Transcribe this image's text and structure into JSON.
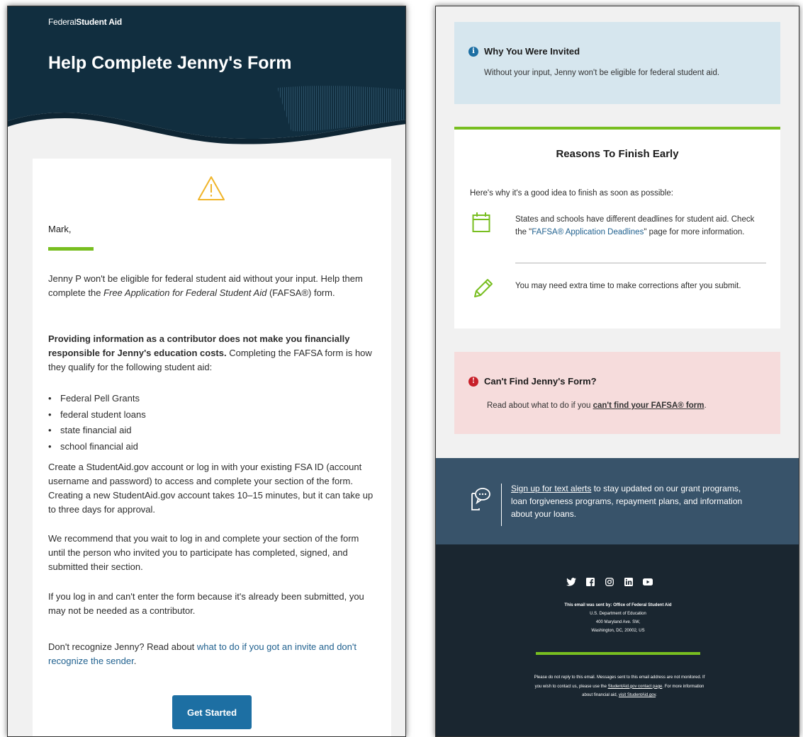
{
  "left": {
    "brand_federal": "Federal",
    "brand_student_aid": "Student Aid",
    "title": "Help Complete Jenny's Form",
    "greeting": "Mark,",
    "para1_a": "Jenny P won't be eligible for federal student aid without your input. Help them complete the ",
    "para1_italic": "Free Application for Federal Student Aid",
    "para1_b": " (FAFSA®) form.",
    "para2_bold": "Providing information as a contributor does not make you financially responsible for Jenny's education costs.",
    "para2_rest": " Completing the FAFSA form is how they qualify for the following student aid:",
    "aid_list": [
      "Federal Pell Grants",
      "federal student loans",
      "state financial aid",
      "school financial aid"
    ],
    "para3": "Create a StudentAid.gov account or log in with your existing FSA ID (account username and password) to access and complete your section of the form. Creating a new StudentAid.gov account takes 10–15 minutes, but it can take up to three days for approval.",
    "para4": "We recommend that you wait to log in and complete your section of the form until the person who invited you to participate has completed, signed, and submitted their section.",
    "para5": "If you log in and can't enter the form because it's already been submitted, you may not be needed as a contributor.",
    "para6_a": "Don't recognize Jenny? Read about ",
    "para6_link": "what to do if you got an invite and don't recognize the sender",
    "para6_b": ".",
    "button": "Get Started"
  },
  "right": {
    "invited_title": "Why You Were Invited",
    "invited_text": "Without your input, Jenny won't be eligible for federal student aid.",
    "reasons_title": "Reasons To Finish Early",
    "reasons_intro": "Here's why it's a good idea to finish as soon as possible:",
    "reason1_a": "States and schools have different deadlines for student aid. Check the \"",
    "reason1_link": "FAFSA® Application Deadlines",
    "reason1_b": "\" page for more information.",
    "reason2": "You may need extra time to make corrections after you submit.",
    "alert_title": "Can't Find Jenny's Form?",
    "alert_text_a": "Read about what to do if you ",
    "alert_link": "can't find your FAFSA® form",
    "alert_text_b": ".",
    "text_alerts_link": "Sign up for text alerts",
    "text_alerts_rest": " to stay updated on our grant programs, loan forgiveness programs, repayment plans, and information about your loans.",
    "footer_sent_by": "This email was sent by: Office of Federal Student Aid",
    "footer_dept": "U.S. Department of Education",
    "footer_street": "400 Maryland Ave. SW,",
    "footer_city": "Washington, DC, 20002, US",
    "footer_note_a": "Please do not reply to this email. Messages sent to this email address are not monitored. If you wish to contact us, please use the ",
    "footer_contact_link": "StudentAid.gov contact page",
    "footer_note_b": ". For more information about financial aid, ",
    "footer_visit_link": "visit StudentAid.gov",
    "footer_note_c": "."
  },
  "colors": {
    "navy": "#112e3f",
    "green": "#78be20",
    "button_blue": "#1d6fa3",
    "info_bg": "#d6e6ee",
    "alert_bg": "#f6dcdc",
    "alert_red": "#c8202a",
    "slate": "#38536a",
    "footer_bg": "#1a2630"
  },
  "icons": [
    "warning-icon",
    "info-icon",
    "calendar-icon",
    "pencil-icon",
    "error-icon",
    "chat-phone-icon",
    "twitter-icon",
    "facebook-icon",
    "instagram-icon",
    "linkedin-icon",
    "youtube-icon"
  ]
}
